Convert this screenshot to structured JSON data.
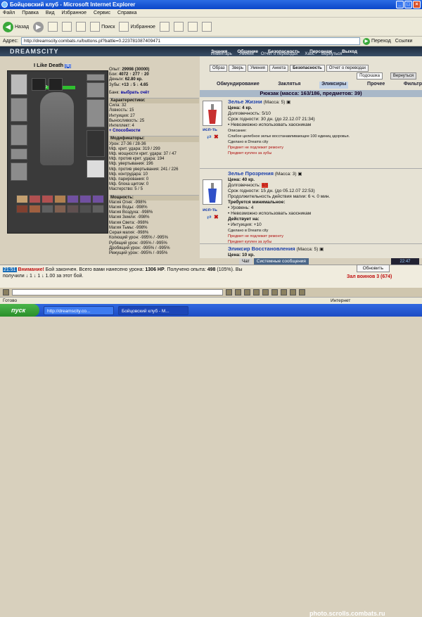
{
  "window": {
    "title": "Бойцовский клуб - Microsoft Internet Explorer"
  },
  "menu": [
    "Файл",
    "Правка",
    "Вид",
    "Избранное",
    "Сервис",
    "Справка"
  ],
  "toolbar": {
    "back": "Назад",
    "search": "Поиск",
    "favorites": "Избранное"
  },
  "address": {
    "label": "Адрес:",
    "url": "http://dreamscity.combats.ru/buttons.pl?battle=0.223781087409471",
    "go": "Переход",
    "links": "Ссылки"
  },
  "site": {
    "logo": "DREAMSCITY",
    "nav": [
      "Знания",
      "Общение",
      "Безопасность",
      "Персонаж",
      "Выход"
    ],
    "subnav": [
      "Инвентарь",
      "Умения",
      "Отчет о переводах",
      "Хаос",
      "Вернуться"
    ]
  },
  "character": {
    "name": "I Like Death",
    "level": "[6]",
    "hp": "570/570",
    "money": [
      {
        "label": "Опыт:",
        "value": "29998 (30000)"
      },
      {
        "label": "Бои:",
        "value": "4072 ↑ 277 ↑ 20"
      },
      {
        "label": "Деньги:",
        "value": "62.80 кр."
      },
      {
        "label": "Зубы:",
        "value": "+13 ↓ 5 ↓ 4.65"
      }
    ],
    "bank": "Банк:",
    "bank_link": "выбрать счёт",
    "attrs_title": "Характеристики:",
    "attrs": [
      "Сила: 32",
      "Ловкость: 15",
      "Интуиция: 27",
      "Выносливость: 25",
      "Интеллект: 4"
    ],
    "abilities": "+ Способности",
    "mods_title": "Модификаторы:",
    "mods": [
      "Урон: 27-36 / 28-36",
      "Мф. крит. удара: 319 / 299",
      "Мф. мощности крит. удара: 37 / 47",
      "Мф. против крит. удара: 194",
      "Мф. увертывания: 196",
      "Мф. против увертывания: 241 / 226",
      "Мф. контрудара: 10",
      "Мф. парирования: 0",
      "Мф. блока щитом: 0",
      "Мастерство: 5 / 5"
    ],
    "power_title": "Мощность:",
    "power": [
      "Магия Огня: -998%",
      "Магия Воды: -998%",
      "Магия Воздуха: -998%",
      "Магия Земли: -998%",
      "Магия Света: -998%",
      "Магия Тьмы: -998%",
      "Серая магия: -998%",
      "Колющий урон: -995% / -995%",
      "Рубящий урон: -995% / -995%",
      "Дробящий урон: -995% / -995%",
      "Режущий урон: -995% / -995%"
    ]
  },
  "right": {
    "buttons": [
      "Образ",
      "Зверь",
      "Умения",
      "Анкета",
      "Безопасность",
      "Отчет о переводах"
    ],
    "hint": "Подсказка",
    "back": "Вернуться",
    "categories": [
      "Обмундирование",
      "Заклятья",
      "Эликсиры",
      "Прочее",
      "Фильтр"
    ],
    "bag_title": "Рюкзак (масса: 163/186, предметов: 39)",
    "use_label": "исп-ть",
    "items": [
      {
        "name": "Зелье Жизни",
        "mass": "(Масса: 5)",
        "price": "Цена: 4 кр.",
        "durability_label": "Долговечность:",
        "durability": "5/10",
        "expiry": "Срок годности: 30 дн. (до 22.12.07 21:34)",
        "req": "• Невозможно использовать хаосникам",
        "desc_title": "Описание:",
        "desc": "Слабое целебное зелье восстанавливающее 100 единиц здоровья.",
        "made": "Сделано в Dreams city",
        "note1": "Предмет не подлежит ремонту",
        "note2": "Предмет куплен за зубы"
      },
      {
        "name": "Зелье Прозрения",
        "mass": "(Масса: 3)",
        "price": "Цена: 40 кр.",
        "durability_label": "Долговечность:",
        "durability": "4/5",
        "expiry": "Срок годности: 15 дн. (до 05.12.07 22:53)",
        "duration": "Продолжительность действия магии: 6 ч. 0 мин.",
        "req_title": "Требуется минимальное:",
        "req1": "• Уровень: 4",
        "req2": "• Невозможно использовать хаосникам",
        "effect_title": "Действует на:",
        "effect": "• Интуиция: +10",
        "made": "Сделано в Dreams city",
        "note1": "Предмет не подлежит ремонту",
        "note2": "Предмет куплен за зубы"
      },
      {
        "name": "Эликсир Восстановления",
        "mass": "(Масса: 5)",
        "price": "Цена: 10 кр."
      }
    ]
  },
  "chat": {
    "time": "21:51",
    "warning": "Внимание!",
    "message": "Бой закончен. Всего вами нанесено урона:",
    "damage": "1306 HP",
    "exp_text": ". Получено опыта:",
    "exp": "498",
    "exp_pct": "(105%). Вы",
    "line2": "получили ↓ 1 ↓ 1 ↓ 1.00 за этот бой.",
    "tabs": [
      "Чат",
      "Системные сообщения"
    ],
    "refresh": "Обновить",
    "hall": "Зал воинов 3 (674)",
    "clock": "22:47"
  },
  "status": {
    "left": "Готово",
    "zone": "Интернет"
  },
  "taskbar": {
    "start": "пуск",
    "tasks": [
      "http://dreamscity.co...",
      "Бойцовский клуб - M..."
    ],
    "watermark": "photo.scrolls.combats.ru"
  }
}
